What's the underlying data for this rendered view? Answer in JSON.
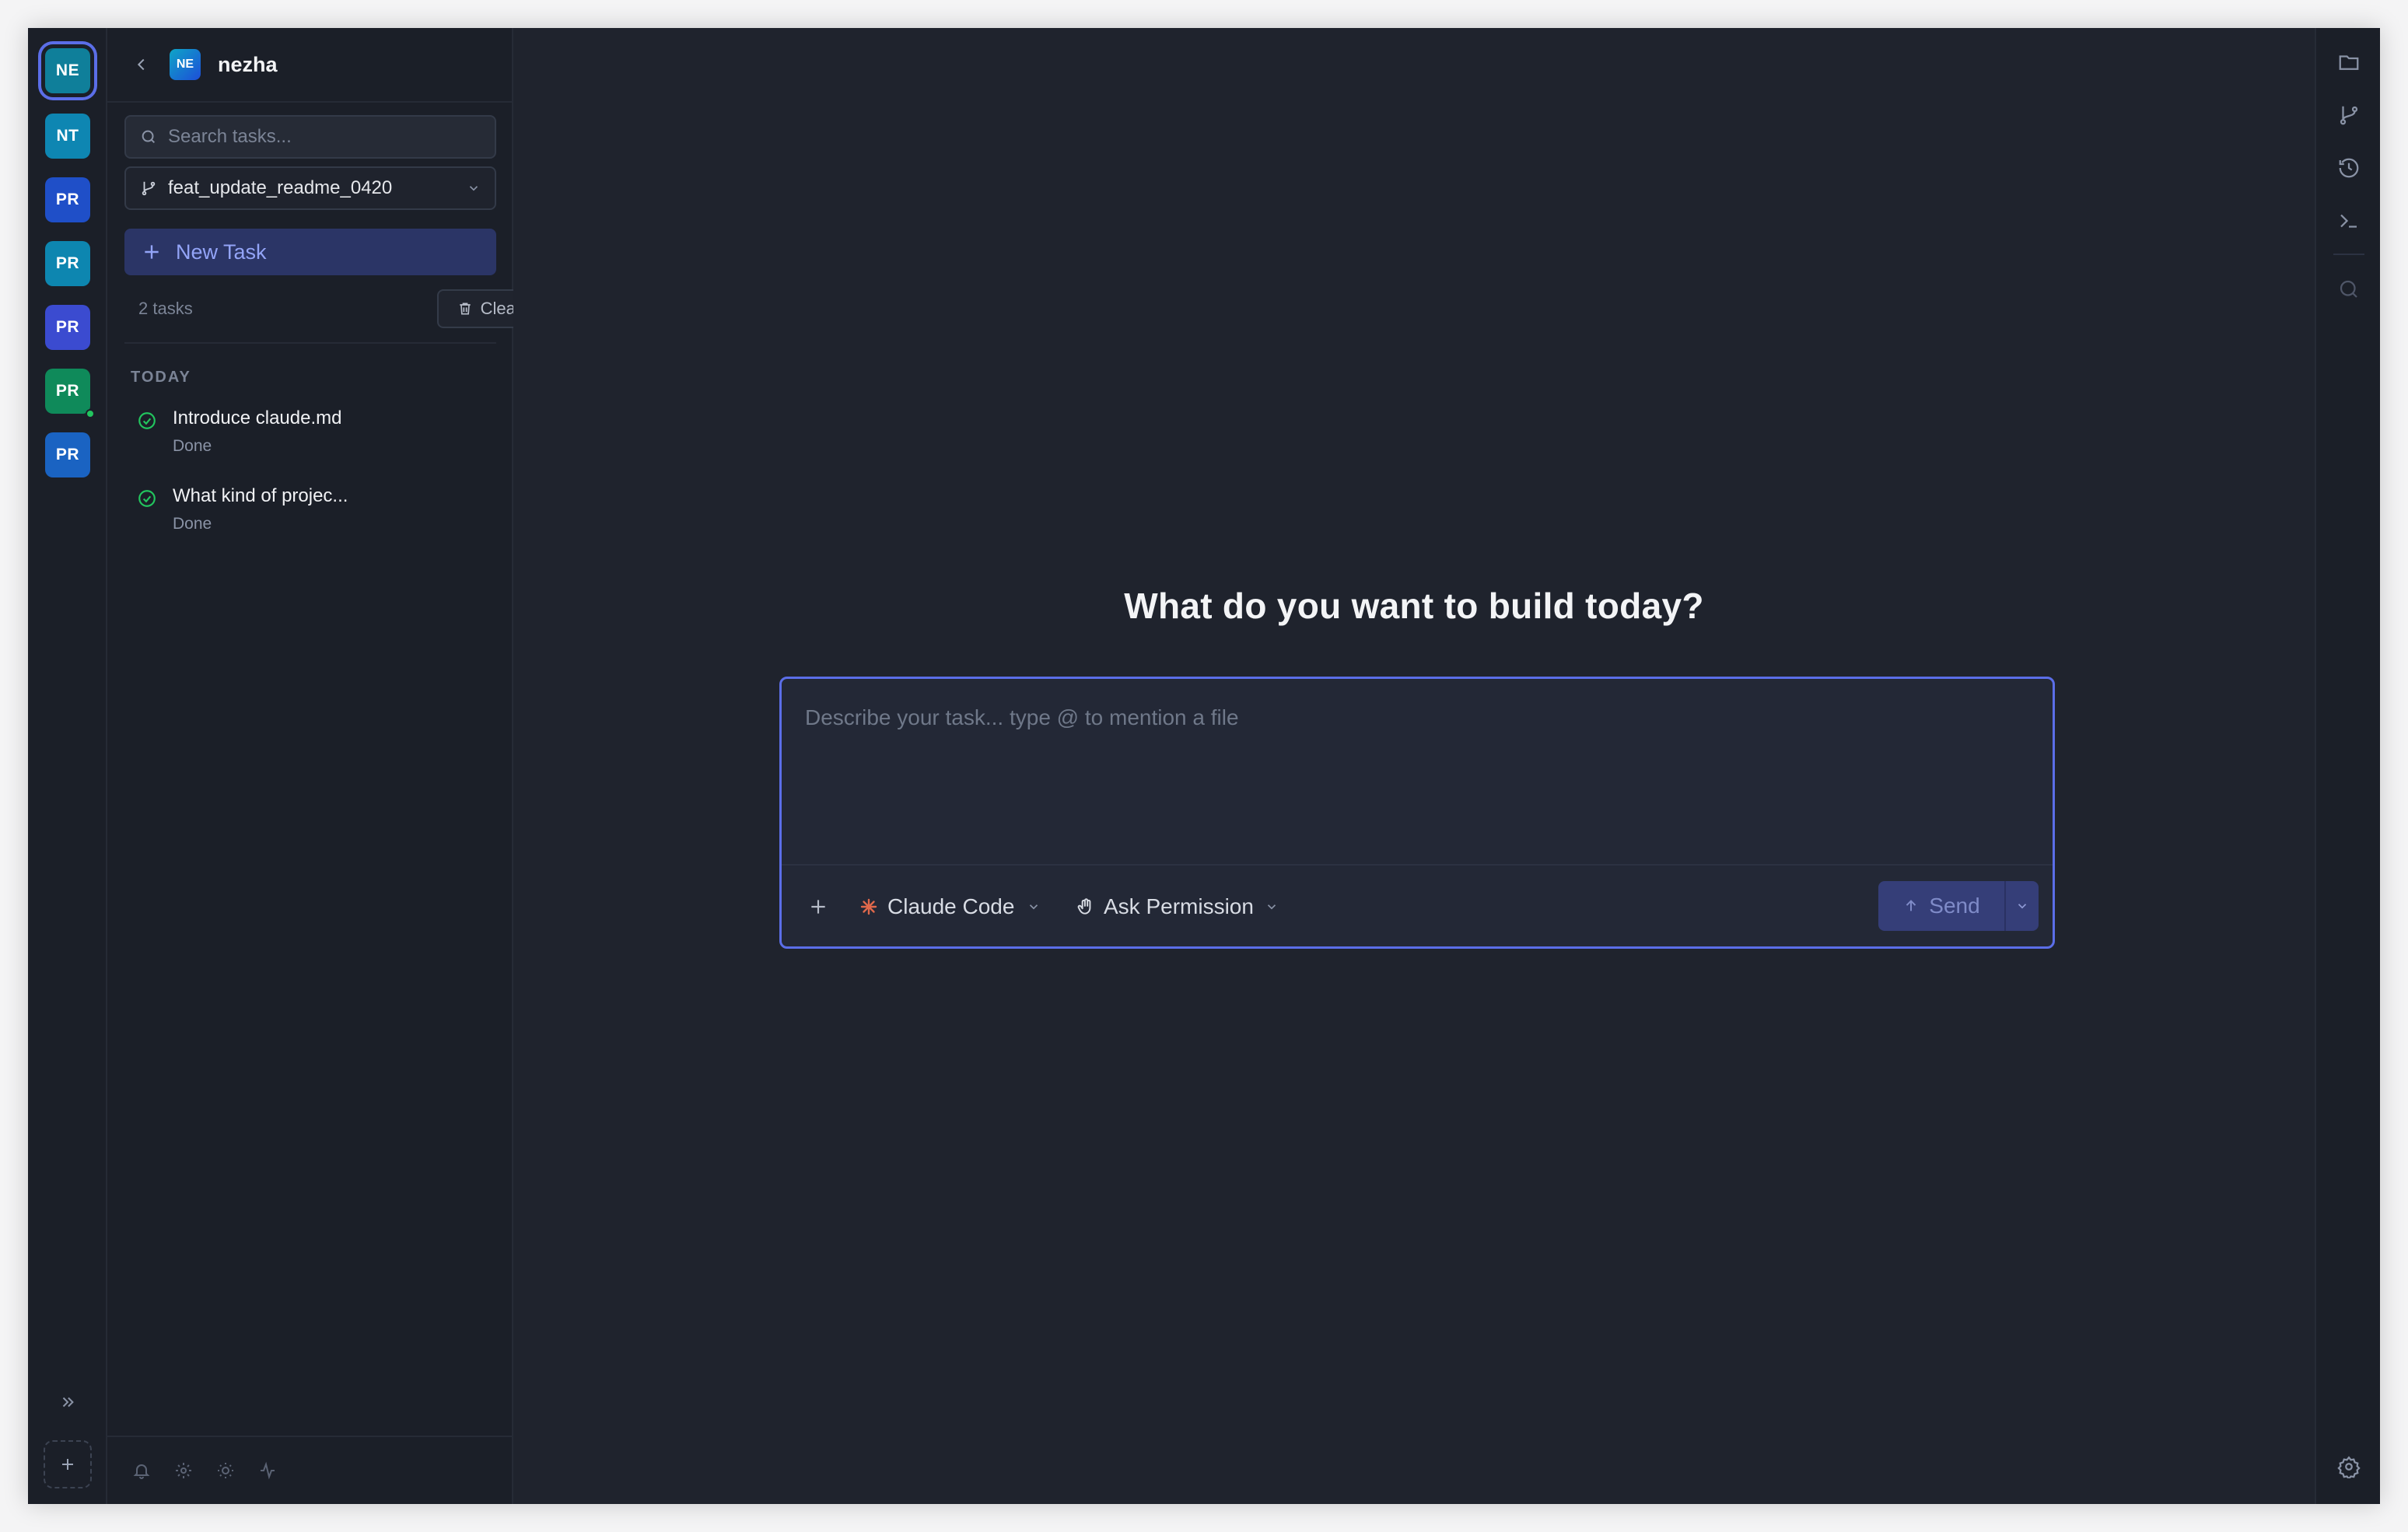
{
  "projects": [
    {
      "initials": "NE",
      "color": "#0f7f9a",
      "active": true,
      "dot": false
    },
    {
      "initials": "NT",
      "color": "#0e86b2",
      "active": false,
      "dot": false
    },
    {
      "initials": "PR",
      "color": "#1f4fc8",
      "active": false,
      "dot": false
    },
    {
      "initials": "PR",
      "color": "#0d86b0",
      "active": false,
      "dot": false
    },
    {
      "initials": "PR",
      "color": "#3b4bd0",
      "active": false,
      "dot": false
    },
    {
      "initials": "PR",
      "color": "#0f8a5a",
      "active": false,
      "dot": true
    },
    {
      "initials": "PR",
      "color": "#1a63c2",
      "active": false,
      "dot": false
    }
  ],
  "sidebar": {
    "avatar": "NE",
    "title": "nezha",
    "search_placeholder": "Search tasks...",
    "branch": "feat_update_readme_0420",
    "new_task": "New Task",
    "task_count": "2 tasks",
    "clear_all": "Clear all",
    "section": "TODAY",
    "tasks": [
      {
        "title": "Introduce claude.md",
        "status": "Done"
      },
      {
        "title": "What kind of projec...",
        "status": "Done"
      }
    ]
  },
  "main": {
    "headline": "What do you want to build today?",
    "composer_placeholder": "Describe your task... type @ to mention a file",
    "model": "Claude Code",
    "permission": "Ask Permission",
    "send": "Send"
  },
  "icons": {
    "rail": [
      "expand-icon",
      "add-project-icon"
    ],
    "footer": [
      "bell-icon",
      "gear-icon",
      "sun-icon",
      "activity-icon"
    ],
    "tools": [
      "folder-icon",
      "git-branch-icon",
      "history-icon",
      "terminal-icon",
      "search-icon",
      "settings-icon"
    ]
  },
  "colors": {
    "accent": "#5b6ee8",
    "success": "#22c55e",
    "claude_brand": "#e0684b"
  }
}
